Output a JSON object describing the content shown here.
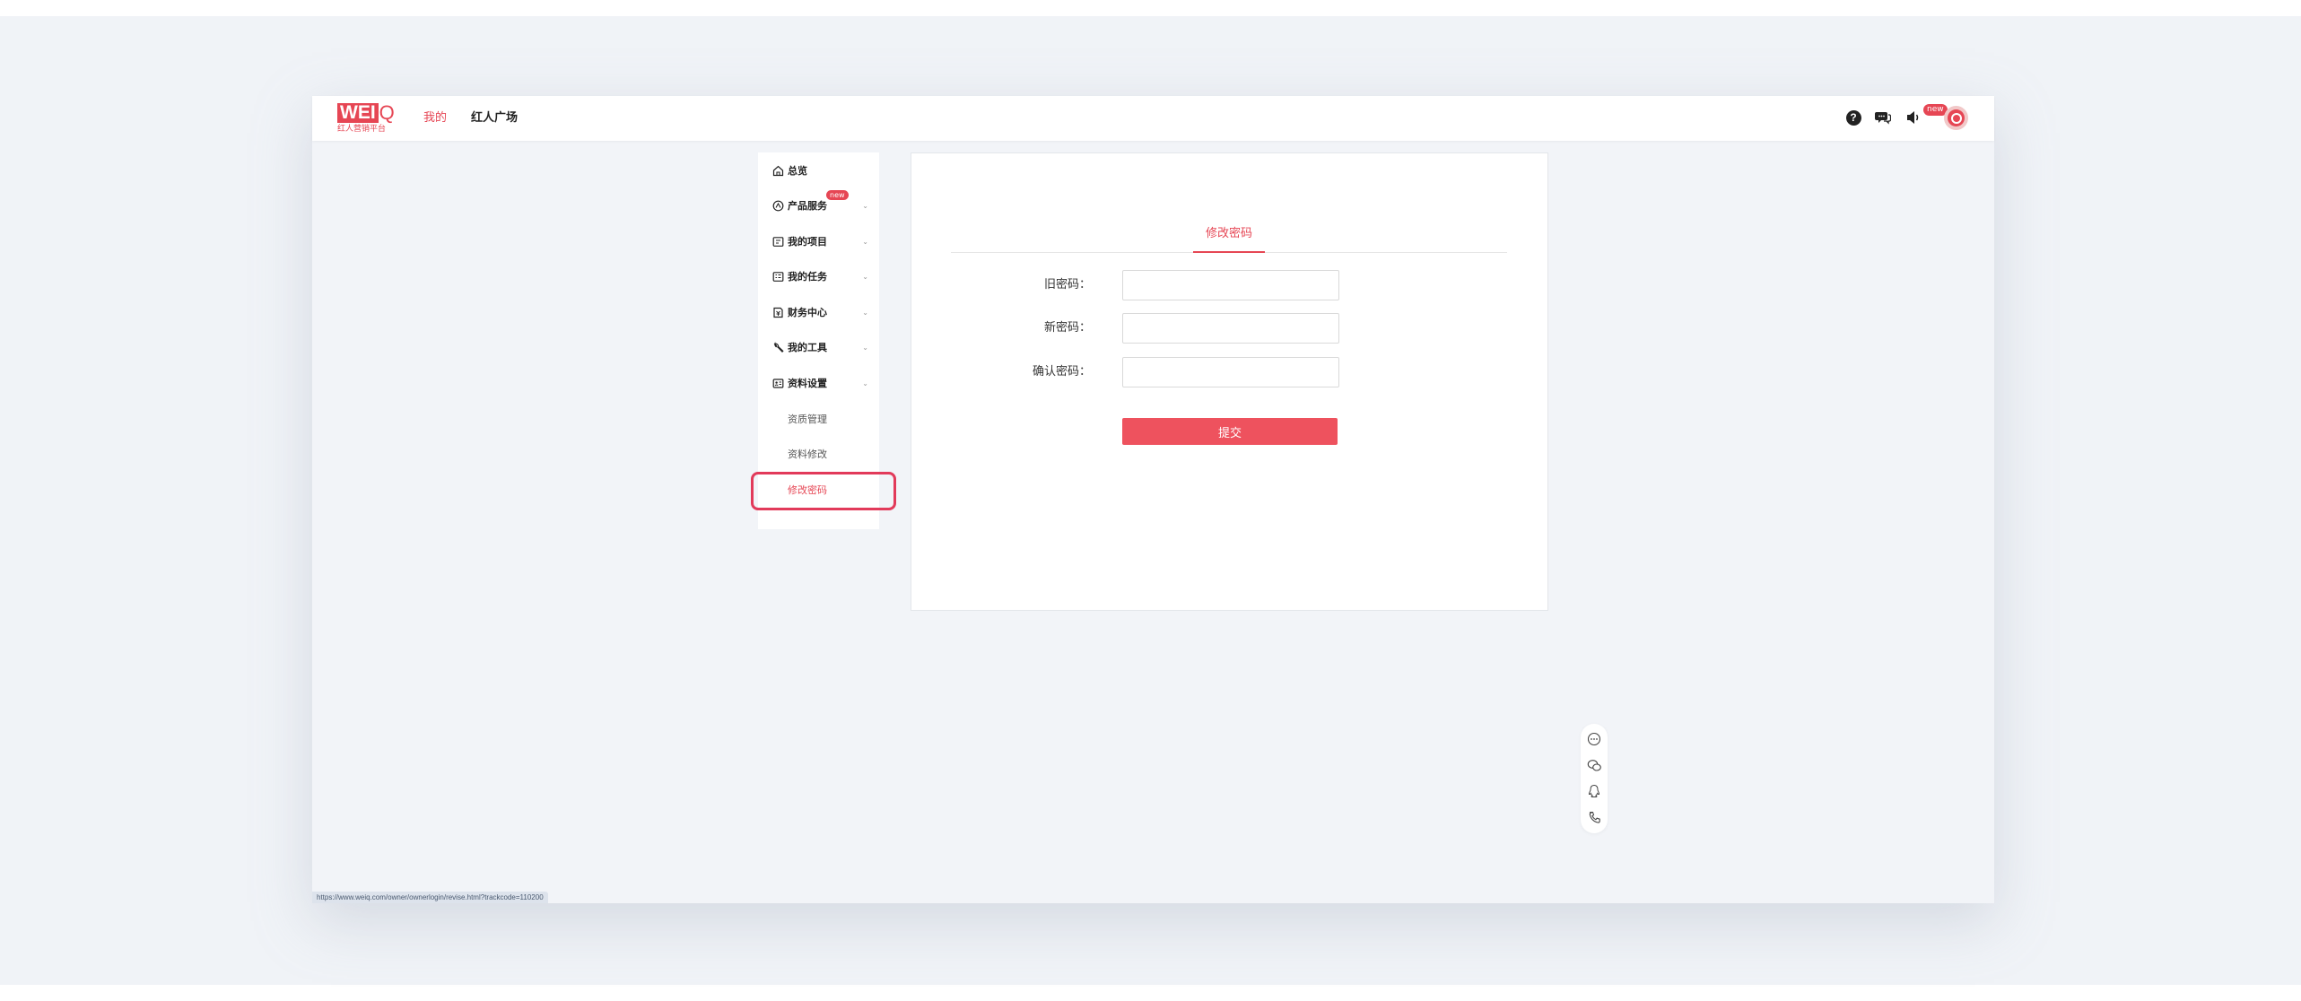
{
  "brand": {
    "logo_text": "WEI",
    "logo_q": "Q",
    "tagline": "红人营销平台"
  },
  "topnav": {
    "mine": "我的",
    "square": "红人广场"
  },
  "topbar_icons": {
    "help": "?",
    "new_badge": "new"
  },
  "sidebar": {
    "items": [
      {
        "label": "总览",
        "icon": "home-icon"
      },
      {
        "label": "产品服务",
        "icon": "service-icon",
        "badge": "new"
      },
      {
        "label": "我的项目",
        "icon": "project-icon"
      },
      {
        "label": "我的任务",
        "icon": "task-icon"
      },
      {
        "label": "财务中心",
        "icon": "finance-icon"
      },
      {
        "label": "我的工具",
        "icon": "tool-icon"
      },
      {
        "label": "资料设置",
        "icon": "profile-icon"
      }
    ],
    "arrow": "⌄",
    "subitems": [
      {
        "label": "资质管理"
      },
      {
        "label": "资料修改"
      },
      {
        "label": "修改密码",
        "active": true
      }
    ]
  },
  "panel": {
    "tab": "修改密码",
    "fields": {
      "old_password": {
        "label": "旧密码：",
        "value": ""
      },
      "new_password": {
        "label": "新密码：",
        "value": ""
      },
      "confirm_password": {
        "label": "确认密码：",
        "value": ""
      }
    },
    "submit": "提交"
  },
  "float_bar": [
    "more-icon",
    "chat-icon",
    "qq-icon",
    "phone-icon"
  ],
  "status_url": "https://www.weiq.com/owner/ownerlogin/revise.html?trackcode=110200",
  "colors": {
    "accent": "#e64654",
    "highlight": "#e23a5a",
    "background": "#f2f4f8"
  }
}
